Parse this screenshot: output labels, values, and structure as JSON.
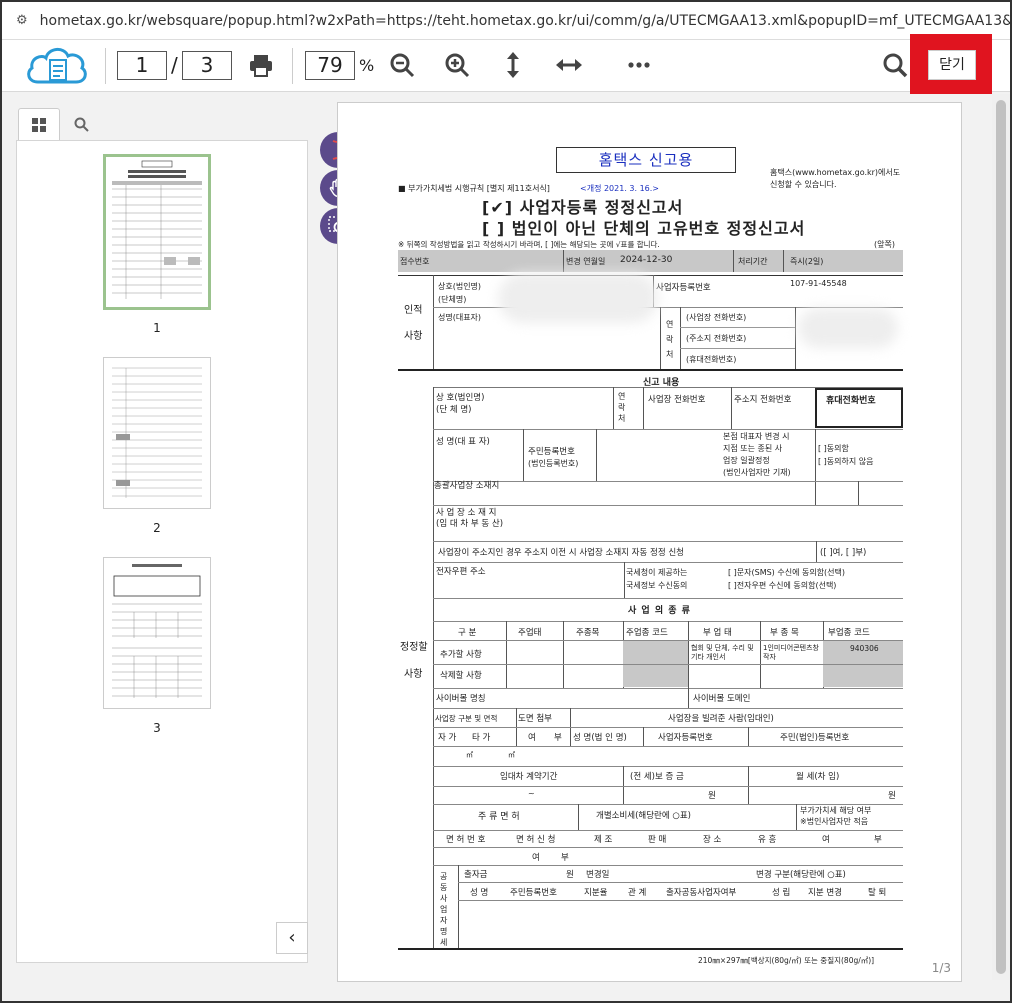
{
  "browser": {
    "url": "hometax.go.kr/websquare/popup.html?w2xPath=https://teht.hometax.go.kr/ui/comm/g/a/UTECMGAA13.xml&popupID=mf_UTECMGAA13&w2xHo..."
  },
  "toolbar": {
    "current_page": "1",
    "total_pages": "3",
    "page_sep": "/",
    "zoom": "79",
    "zoom_unit": "%",
    "close_label": "닫기"
  },
  "thumbs": {
    "p1": "1",
    "p2": "2",
    "p3": "3"
  },
  "doc": {
    "stamp": "홈택스 신고용",
    "hometax_note1": "홈택스(www.hometax.go.kr)에서도",
    "hometax_note2": "신청할 수 있습니다.",
    "law_ref": "■ 부가가치세법 시행규칙 [별지 제11호서식]",
    "revision": "<개정 2021. 3. 16.>",
    "title1": "[✔] 사업자등록 정정신고서",
    "title2": "[  ] 법인이 아닌 단체의 고유번호 정정신고서",
    "instruction": "※ 뒤쪽의 작성방법을 읽고 작성하시기 바라며, [  ]에는 해당되는 곳에 √표를 합니다.",
    "front": "(앞쪽)",
    "receipt_no": "접수번호",
    "change_date_label": "변경 연월일",
    "change_date": "2024-12-30",
    "period_label": "처리기간",
    "period": "즉시(2일)",
    "sec_person": "인적",
    "sec_person2": "사항",
    "trade_name": "상호(법인명)",
    "org_name": "(단체명)",
    "biz_no_label": "사업자등록번호",
    "biz_no": "107-91-45548",
    "rep_name": "성명(대표자)",
    "contact_v1": "연",
    "contact_v2": "락",
    "contact_v3": "처",
    "biz_phone": "(사업장 전화번호)",
    "home_phone": "(주소지 전화번호)",
    "mobile_phone": "(휴대전화번호)",
    "report_content": "신고 내용",
    "c_trade": "상 호(법인명)",
    "c_org": "(단 체 명)",
    "c_contact": "연락처",
    "c_biz_phone": "사업장 전화번호",
    "c_home_phone": "주소지 전화번호",
    "c_mobile": "휴대전화번호",
    "c_rep": "성 명(대 표 자)",
    "c_resid": "주민등록번호",
    "c_corp_no": "(법인등록번호)",
    "c_hq1": "본점 대표자 변경 시",
    "c_hq2": "지점 또는 종된 사",
    "c_hq3": "업장 일괄정정",
    "c_hq4": "(법인사업자만 기재)",
    "c_agree": "[  ]동의함",
    "c_disagree": "[  ]동의하지 않음",
    "c_main_loc": "총괄사업장 소재지",
    "c_biz_loc1": "사 업 장  소 재 지",
    "c_biz_loc2": "(임 대 차 부 동 산)",
    "c_auto": "사업장이 주소지인 경우 주소지 이전 시 사업장 소재지 자동 정정 신청",
    "c_yesno": "([ ]여, [ ]부)",
    "c_email": "전자우편 주소",
    "c_nts1": "국세청이 제공하는",
    "c_nts2": "국세정보 수신동의",
    "c_sms": "[  ]문자(SMS) 수신에 동의함(선택)",
    "c_mail": "[  ]전자우편 수신에 동의함(선택)",
    "sec_edit1": "정정할",
    "sec_edit2": "사항",
    "biz_type": "사 업 의  종 류",
    "h_div": "구 분",
    "h_main": "주업태",
    "h_item": "주종목",
    "h_code": "주업종 코드",
    "h_sub": "부 업 태",
    "h_subitem": "부 종 목",
    "h_subcode": "부업종 코드",
    "add_row": "추가할 사항",
    "del_row": "삭제할 사항",
    "add_sub": "협회 및 단체, 수리 및 기타 개인서",
    "add_subitem": "1인미디어콘텐츠창작자",
    "add_code": "940306",
    "cyber_name": "사이버몰 명칭",
    "cyber_domain": "사이버몰 도메인",
    "site_type": "사업장 구분 및 면적",
    "drawing": "도면 첨부",
    "lender": "사업장을 빌려준 사람(임대인)",
    "own": "자 가",
    "rent": "타 가",
    "yes": "여",
    "no": "부",
    "l_name": "성 명(법 인 명)",
    "l_bizno": "사업자등록번호",
    "l_resid": "주민(법인)등록번호",
    "sqm": "㎡",
    "lease_period": "임대차 계약기간",
    "deposit": "(전 세)보 증 금",
    "monthly": "월 세(차 임)",
    "tilde": "~",
    "won": "원",
    "license": "주 류 면 허",
    "excise": "개별소비세(해당란에 ○표)",
    "vat1": "부가가치세 해당 여부",
    "vat2": "※법인사업자만 적음",
    "lic_no": "면 허 번 호",
    "lic_apply": "면 허 신 청",
    "manuf": "제 조",
    "sales": "판 매",
    "venue": "장 소",
    "ent": "유 흥",
    "partner": "공동사업자명세",
    "invest": "출자금",
    "change_day": "변경일",
    "change_type": "변경 구분(해당란에 ○표)",
    "p_name": "성 명",
    "p_resid": "주민등록번호",
    "p_share": "지분율",
    "p_rel": "관 계",
    "p_rep": "출자공동사업자여부",
    "p_est": "성 립",
    "p_chg": "지분 변경",
    "p_exit": "탈 퇴",
    "paper": "210㎜×297㎜[백상지(80g/㎡) 또는 중질지(80g/㎡)]",
    "page_of": "1/3"
  }
}
